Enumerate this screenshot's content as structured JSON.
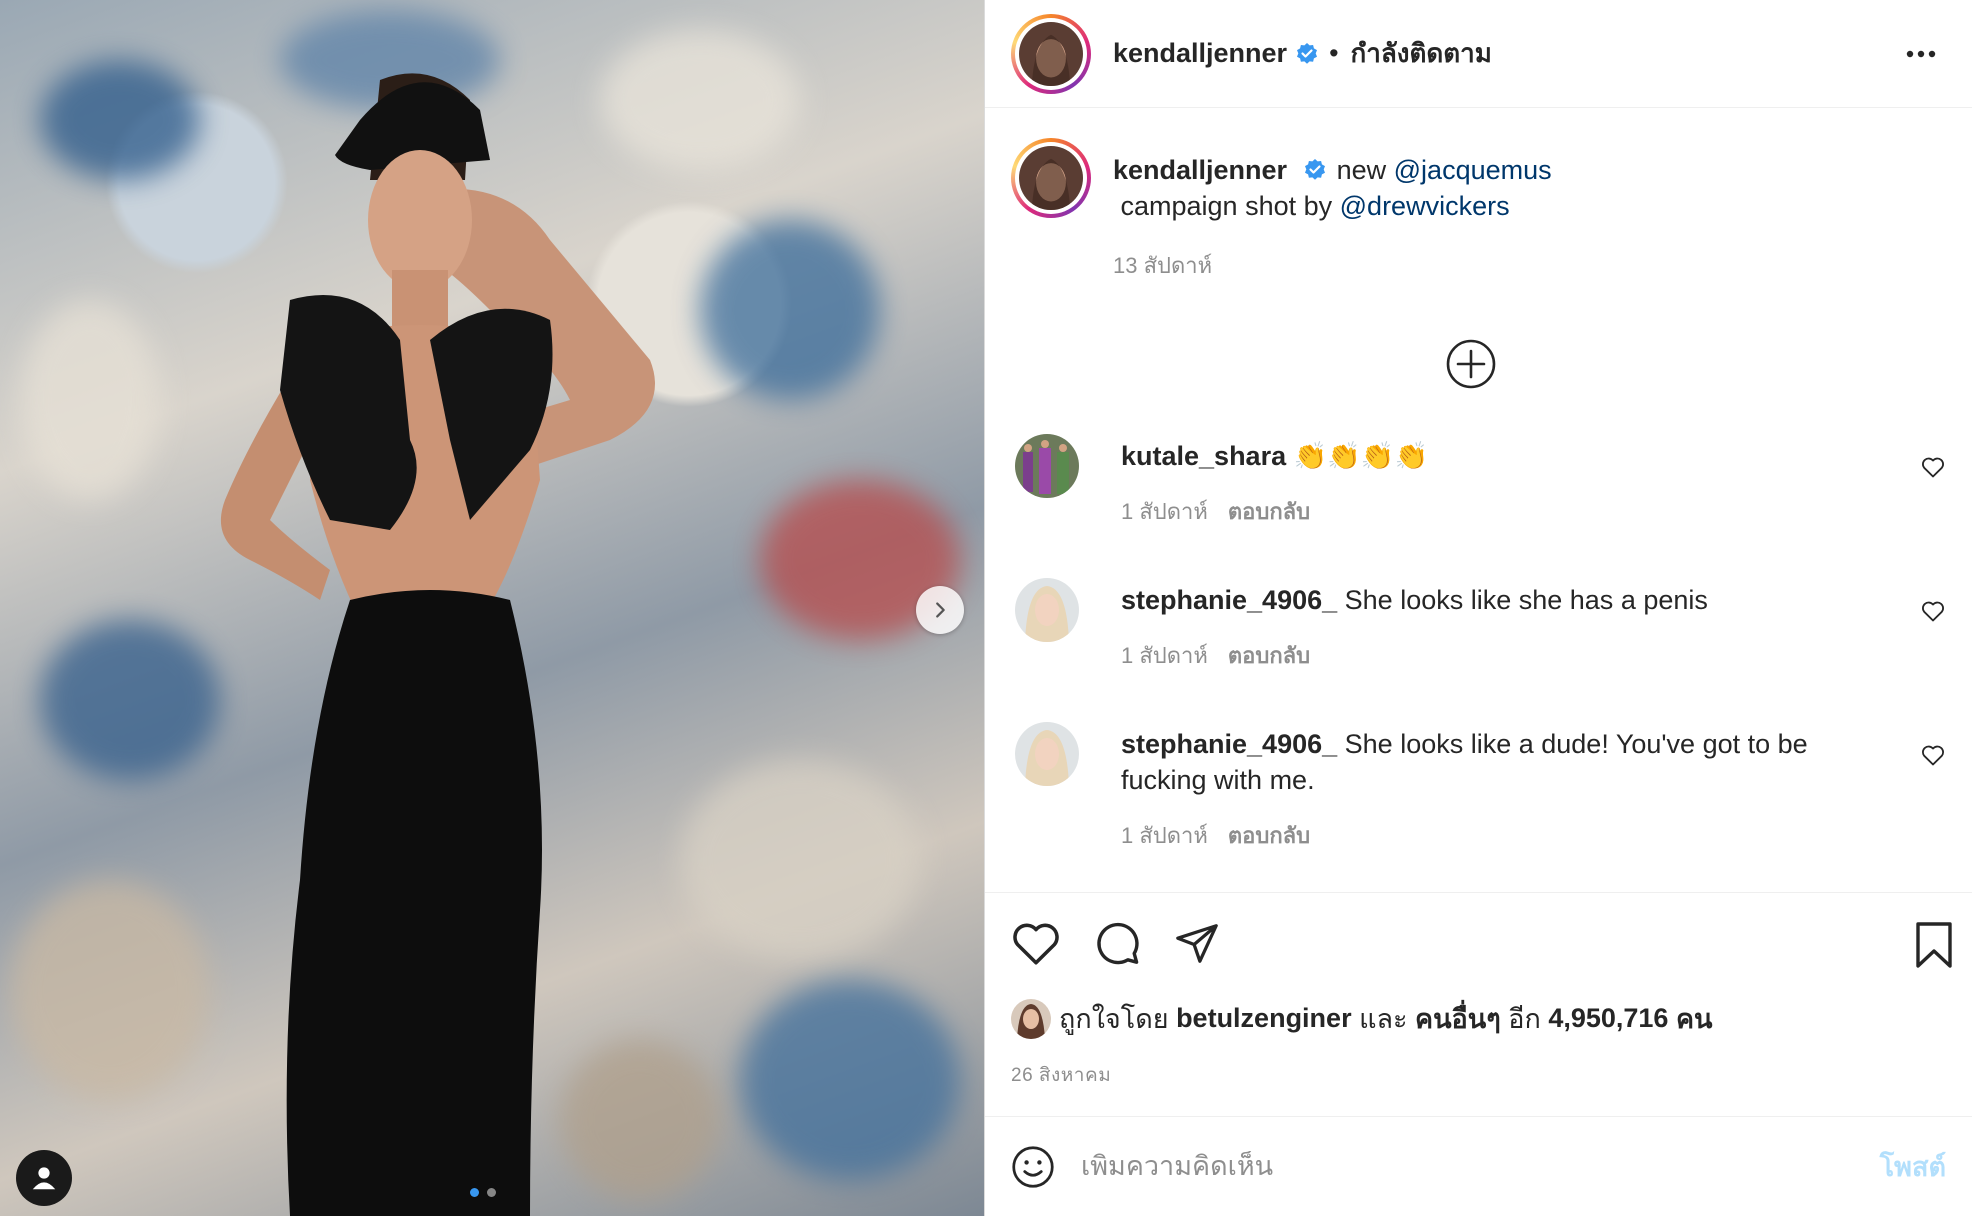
{
  "header": {
    "username": "kendalljenner",
    "separator": "•",
    "follow_status": "กำลังติดตาม",
    "more_icon": "more-horizontal-icon"
  },
  "caption": {
    "username": "kendalljenner",
    "text_before": "new ",
    "mention_1": "@jacquemus",
    "text_middle": " campaign shot by ",
    "mention_2": "@drewvickers",
    "time": "13 สัปดาห์"
  },
  "load_more_icon": "plus-circle-icon",
  "comments": [
    {
      "username": "kutale_shara",
      "text": "👏👏👏👏",
      "time": "1 สัปดาห์",
      "reply": "ตอบกลับ"
    },
    {
      "username": "stephanie_4906_",
      "text": "She looks like she has a penis",
      "time": "1 สัปดาห์",
      "reply": "ตอบกลับ"
    },
    {
      "username": "stephanie_4906_",
      "text": "She looks like a dude! You've got to be fucking with me.",
      "time": "1 สัปดาห์",
      "reply": "ตอบกลับ"
    }
  ],
  "likes": {
    "prefix": "ถูกใจโดย ",
    "first_user": "betulzenginer",
    "and": " และ ",
    "others": "คนอื่นๆ",
    "count_prefix": " อีก ",
    "count": "4,950,716",
    "count_suffix": " คน"
  },
  "date": "26 สิงหาคม",
  "add_comment": {
    "placeholder": "เพิ่มความคิดเห็น",
    "post_label": "โพสต์"
  },
  "carousel": {
    "slides": 2,
    "active": 1
  },
  "colors": {
    "link": "#00376b",
    "verified": "#3897f0",
    "muted": "#8e8e8e",
    "post_disabled": "#b2dffc"
  }
}
